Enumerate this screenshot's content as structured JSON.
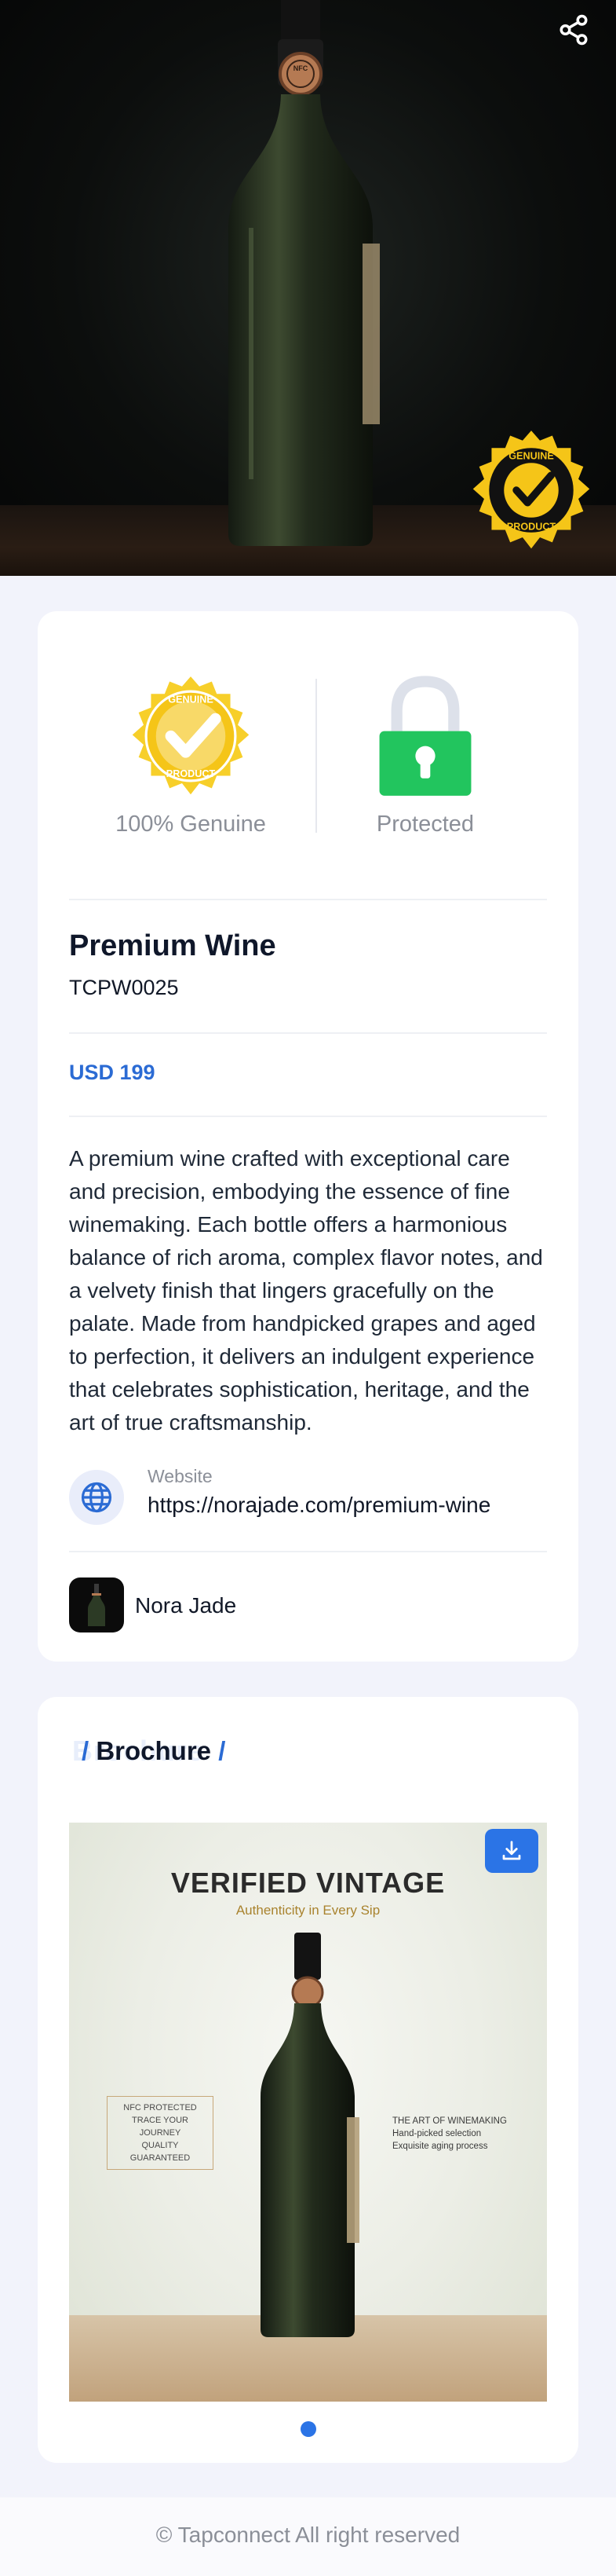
{
  "hero": {
    "image_subject": "wine-bottle-product-photo",
    "badge_text": "GENUINE PRODUCT",
    "cap_text": "NFC"
  },
  "features": {
    "genuine_label": "100% Genuine",
    "protected_label": "Protected",
    "badge_text": "GENUINE PRODUCT"
  },
  "product": {
    "name": "Premium Wine",
    "code": "TCPW0025",
    "price": "USD 199",
    "description": "A premium wine crafted with exceptional care and precision, embodying the essence of fine winemaking. Each bottle offers a harmonious balance of rich aroma, complex flavor notes, and a velvety finish that lingers gracefully on the palate. Made from handpicked grapes and aged to perfection, it delivers an indulgent experience that celebrates sophistication, heritage, and the art of true craftsmanship."
  },
  "website": {
    "label": "Website",
    "url": "https://norajade.com/premium-wine"
  },
  "brand": {
    "name": "Nora Jade"
  },
  "brochure": {
    "title_slash": "/",
    "title": "Brochure",
    "title_end": "/",
    "image": {
      "headline": "VERIFIED VINTAGE",
      "tagline": "Authenticity in Every Sip",
      "left_note": [
        "NFC PROTECTED",
        "TRACE YOUR JOURNEY",
        "QUALITY GUARANTEED"
      ],
      "right_note": [
        "THE ART OF WINEMAKING",
        "Hand-picked selection",
        "Exquisite aging process"
      ]
    },
    "pages": 1,
    "current_page": 1
  },
  "footer": {
    "text": "© Tapconnect All right reserved"
  },
  "colors": {
    "accent": "#2b6bd4",
    "badge_gold": "#f5c518",
    "lock_green": "#22c55e",
    "background": "#f2f3fb"
  }
}
